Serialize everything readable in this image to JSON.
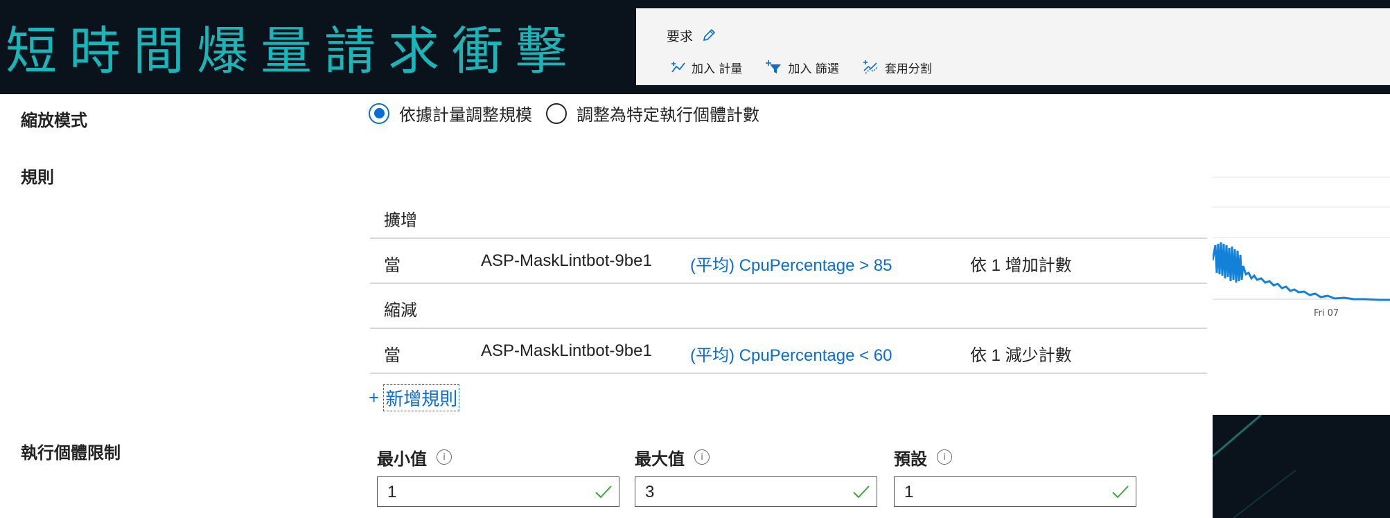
{
  "slide": {
    "title": "短時間爆量請求衝擊"
  },
  "metrics": {
    "title": "要求",
    "toolbar": {
      "add_metric": "加入 計量",
      "add_filter": "加入 篩選",
      "apply_split": "套用分割"
    }
  },
  "chart": {
    "x_tick": "Fri 07"
  },
  "settings": {
    "scale_mode_label": "縮放模式",
    "scale_mode_options": [
      "依據計量調整規模",
      "調整為特定執行個體計數"
    ],
    "scale_mode_selected": "依據計量調整規模",
    "rules_label": "規則",
    "rules": {
      "scale_out_header": "擴增",
      "scale_in_header": "縮減",
      "scale_out": {
        "when": "當",
        "resource": "ASP-MaskLintbot-9be1",
        "condition": "(平均) CpuPercentage > 85",
        "action": "依 1 增加計數"
      },
      "scale_in": {
        "when": "當",
        "resource": "ASP-MaskLintbot-9be1",
        "condition": "(平均) CpuPercentage < 60",
        "action": "依 1 減少計數"
      }
    },
    "add_rule": "新增規則",
    "instance_limits_label": "執行個體限制",
    "limits": {
      "minimum_label": "最小值",
      "minimum_value": "1",
      "maximum_label": "最大值",
      "maximum_value": "3",
      "default_label": "預設",
      "default_value": "1"
    }
  }
}
